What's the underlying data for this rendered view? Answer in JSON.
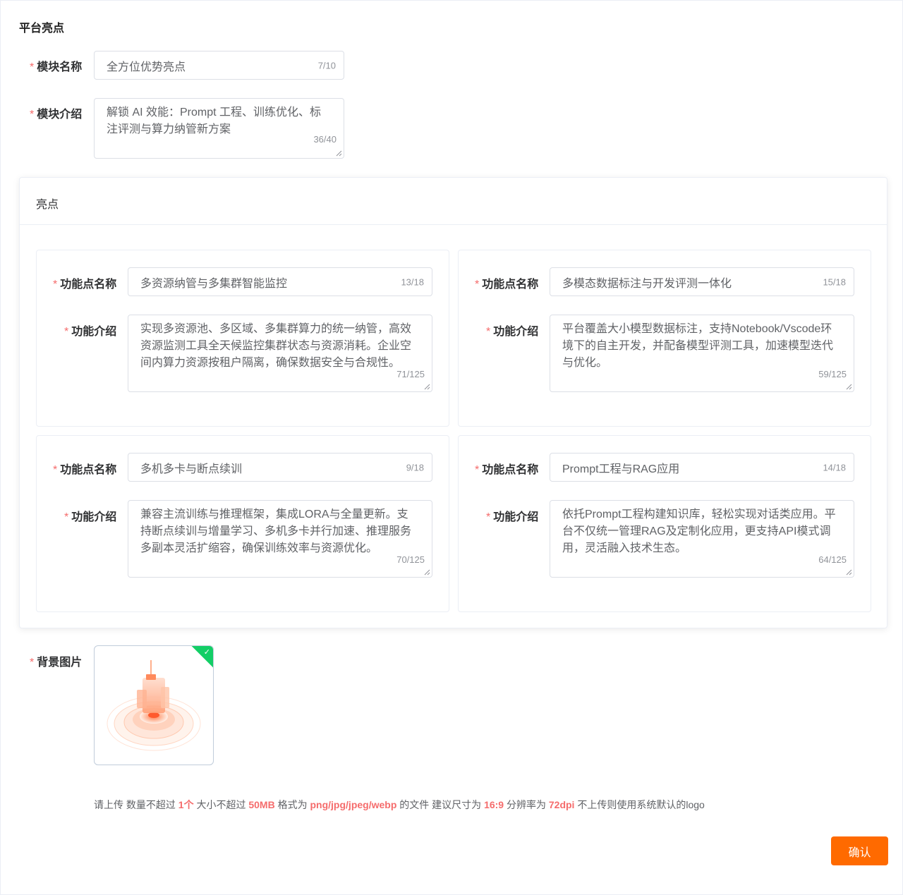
{
  "section_title": "平台亮点",
  "module": {
    "name_label": "模块名称",
    "name_value": "全方位优势亮点",
    "name_count": "7/10",
    "intro_label": "模块介绍",
    "intro_value": "解锁 AI 效能：Prompt 工程、训练优化、标注评测与算力纳管新方案",
    "intro_count": "36/40"
  },
  "highlights": {
    "title": "亮点",
    "cards": [
      {
        "name_label": "功能点名称",
        "name_value": "多资源纳管与多集群智能监控",
        "name_count": "13/18",
        "intro_label": "功能介绍",
        "intro_value": "实现多资源池、多区域、多集群算力的统一纳管，高效资源监测工具全天候监控集群状态与资源消耗。企业空间内算力资源按租户隔离，确保数据安全与合规性。",
        "intro_count": "71/125"
      },
      {
        "name_label": "功能点名称",
        "name_value": "多模态数据标注与开发评测一体化",
        "name_count": "15/18",
        "intro_label": "功能介绍",
        "intro_value": "平台覆盖大小模型数据标注，支持Notebook/Vscode环境下的自主开发，并配备模型评测工具，加速模型迭代与优化。",
        "intro_count": "59/125"
      },
      {
        "name_label": "功能点名称",
        "name_value": "多机多卡与断点续训",
        "name_count": "9/18",
        "intro_label": "功能介绍",
        "intro_value": "兼容主流训练与推理框架，集成LORA与全量更新。支持断点续训与增量学习、多机多卡并行加速、推理服务多副本灵活扩缩容，确保训练效率与资源优化。",
        "intro_count": "70/125"
      },
      {
        "name_label": "功能点名称",
        "name_value": "Prompt工程与RAG应用",
        "name_count": "14/18",
        "intro_label": "功能介绍",
        "intro_value": "依托Prompt工程构建知识库，轻松实现对话类应用。平台不仅统一管理RAG及定制化应用，更支持API模式调用，灵活融入技术生态。",
        "intro_count": "64/125"
      }
    ]
  },
  "background": {
    "label": "背景图片",
    "status_icon": "check-icon",
    "tip": {
      "p1": "请上传 数量不超过 ",
      "count": "1个",
      "p2": " 大小不超过 ",
      "size": "50MB",
      "p3": " 格式为 ",
      "formats": "png/jpg/jpeg/webp",
      "p4": " 的文件 建议尺寸为 ",
      "ratio": "16:9",
      "p5": " 分辨率为 ",
      "dpi": "72dpi",
      "p6": " 不上传则使用系统默认的logo"
    }
  },
  "confirm_label": "确认",
  "colors": {
    "accent": "#ff6a00",
    "required": "#f56c6c",
    "success": "#13ce66"
  }
}
